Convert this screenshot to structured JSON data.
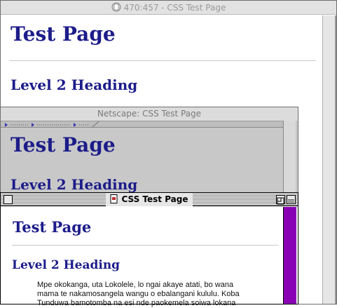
{
  "window_back": {
    "title": "470:457 - CSS Test Page",
    "heading1": "Test Page",
    "heading2": "Level 2 Heading"
  },
  "window_middle": {
    "title": "Netscape: CSS Test Page",
    "heading1": "Test Page",
    "heading2": "Level 2 Heading"
  },
  "window_front": {
    "title": "CSS Test Page",
    "heading1": "Test Page",
    "heading2": "Level 2 Heading",
    "paragraph": "Mpe okokanga, uta Lokolele, lo ngai akaye atati, bo wana mama te nakamosangela wangu o ebalangani kululu. Koba Tunduwa bamotomba na esi nde paokemela soiwa lokana"
  },
  "colors": {
    "heading": "#1c1c8a",
    "scrollbar_accent": "#8a00b4"
  }
}
